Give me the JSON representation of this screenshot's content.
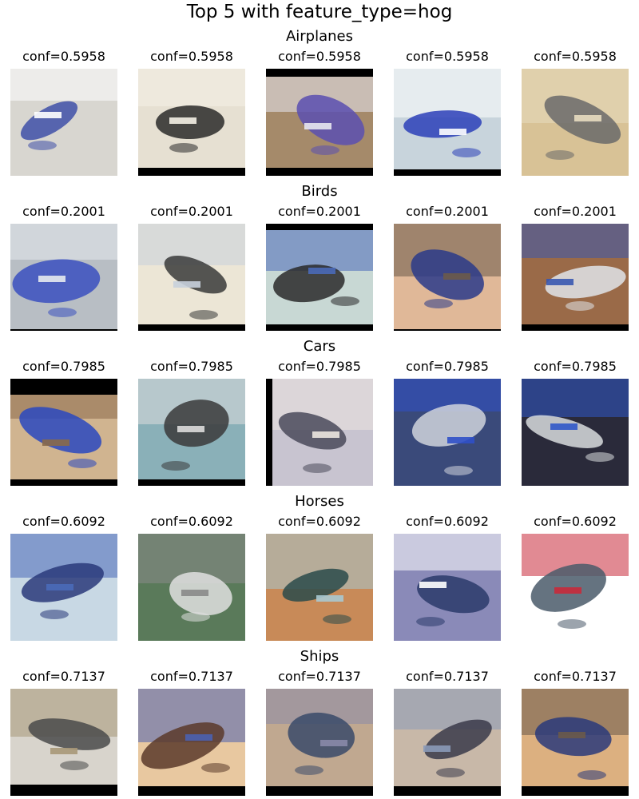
{
  "title": "Top 5 with feature_type=hog",
  "rows": [
    {
      "label": "Airplanes",
      "confs": [
        "conf=0.5958",
        "conf=0.5958",
        "conf=0.5958",
        "conf=0.5958",
        "conf=0.5958"
      ],
      "images": [
        {
          "icon": "inverted-airplane-photo",
          "bg": "#d8d6d0",
          "fg": "#4050a8",
          "accent": "#ffffff"
        },
        {
          "icon": "inverted-airplane-photo",
          "bg": "#e6e0d2",
          "fg": "#2a2a2a",
          "accent": "#f4f0e6"
        },
        {
          "icon": "inverted-airplane-photo",
          "bg": "#a58a6a",
          "fg": "#5a4fb0",
          "accent": "#e8e8f0"
        },
        {
          "icon": "inverted-airplane-photo",
          "bg": "#c8d4dc",
          "fg": "#2c3fb8",
          "accent": "#ffffff"
        },
        {
          "icon": "inverted-airplane-photo",
          "bg": "#d8c296",
          "fg": "#6a6a6a",
          "accent": "#e8dcc0"
        }
      ]
    },
    {
      "label": "Birds",
      "confs": [
        "conf=0.2001",
        "conf=0.2001",
        "conf=0.2001",
        "conf=0.2001",
        "conf=0.2001"
      ],
      "images": [
        {
          "icon": "inverted-bird-photo",
          "bg": "#b8bec4",
          "fg": "#3a50c0",
          "accent": "#e6eaee"
        },
        {
          "icon": "inverted-bird-photo",
          "bg": "#ece6d6",
          "fg": "#3a3a3a",
          "accent": "#c8d0dc"
        },
        {
          "icon": "inverted-bird-photo",
          "bg": "#c8d8d4",
          "fg": "#2a2a2a",
          "accent": "#4a6ab8"
        },
        {
          "icon": "inverted-bird-photo",
          "bg": "#e0b898",
          "fg": "#2a3a8a",
          "accent": "#6a5a4a"
        },
        {
          "icon": "inverted-bird-photo",
          "bg": "#9a6a48",
          "fg": "#e0e4ea",
          "accent": "#3a58b0"
        }
      ]
    },
    {
      "label": "Cars",
      "confs": [
        "conf=0.7985",
        "conf=0.7985",
        "conf=0.7985",
        "conf=0.7985",
        "conf=0.7985"
      ],
      "images": [
        {
          "icon": "inverted-car-photo",
          "bg": "#d0b490",
          "fg": "#2a48c0",
          "accent": "#8a6a4a"
        },
        {
          "icon": "inverted-car-photo",
          "bg": "#8ab0b8",
          "fg": "#3a3a3a",
          "accent": "#dcdcdc"
        },
        {
          "icon": "inverted-car-photo",
          "bg": "#c8c4d0",
          "fg": "#4a4a5a",
          "accent": "#ece6e0"
        },
        {
          "icon": "inverted-car-photo",
          "bg": "#3a4a7a",
          "fg": "#d0d4dc",
          "accent": "#3050c8"
        },
        {
          "icon": "inverted-car-photo",
          "bg": "#2a2a3a",
          "fg": "#d8dcde",
          "accent": "#3058c8"
        }
      ]
    },
    {
      "label": "Horses",
      "confs": [
        "conf=0.6092",
        "conf=0.6092",
        "conf=0.6092",
        "conf=0.6092",
        "conf=0.6092"
      ],
      "images": [
        {
          "icon": "inverted-horse-photo",
          "bg": "#c8d8e4",
          "fg": "#2a3a7a",
          "accent": "#4a6ab8"
        },
        {
          "icon": "inverted-horse-photo",
          "bg": "#5a7a5a",
          "fg": "#e0e0e0",
          "accent": "#8a8a8a"
        },
        {
          "icon": "inverted-horse-photo",
          "bg": "#c88a58",
          "fg": "#2a4a4a",
          "accent": "#a8c8d0"
        },
        {
          "icon": "inverted-horse-photo",
          "bg": "#8a8ab8",
          "fg": "#2a3a6a",
          "accent": "#ffffff"
        },
        {
          "icon": "inverted-horse-photo",
          "bg": "#ffffff",
          "fg": "#4a5a6a",
          "accent": "#c82a3a"
        }
      ]
    },
    {
      "label": "Ships",
      "confs": [
        "conf=0.7137",
        "conf=0.7137",
        "conf=0.7137",
        "conf=0.7137",
        "conf=0.7137"
      ],
      "images": [
        {
          "icon": "inverted-ship-photo",
          "bg": "#d8d4cc",
          "fg": "#4a4a4a",
          "accent": "#a89878"
        },
        {
          "icon": "inverted-ship-photo",
          "bg": "#e8c8a0",
          "fg": "#5a3a2a",
          "accent": "#4a60b0"
        },
        {
          "icon": "inverted-ship-photo",
          "bg": "#c0a890",
          "fg": "#3a4a6a",
          "accent": "#8a8aa8"
        },
        {
          "icon": "inverted-ship-photo",
          "bg": "#c8b8a8",
          "fg": "#3a3a4a",
          "accent": "#8a9ab8"
        },
        {
          "icon": "inverted-ship-photo",
          "bg": "#dcb080",
          "fg": "#2a3a7a",
          "accent": "#6a5a4a"
        }
      ]
    }
  ]
}
